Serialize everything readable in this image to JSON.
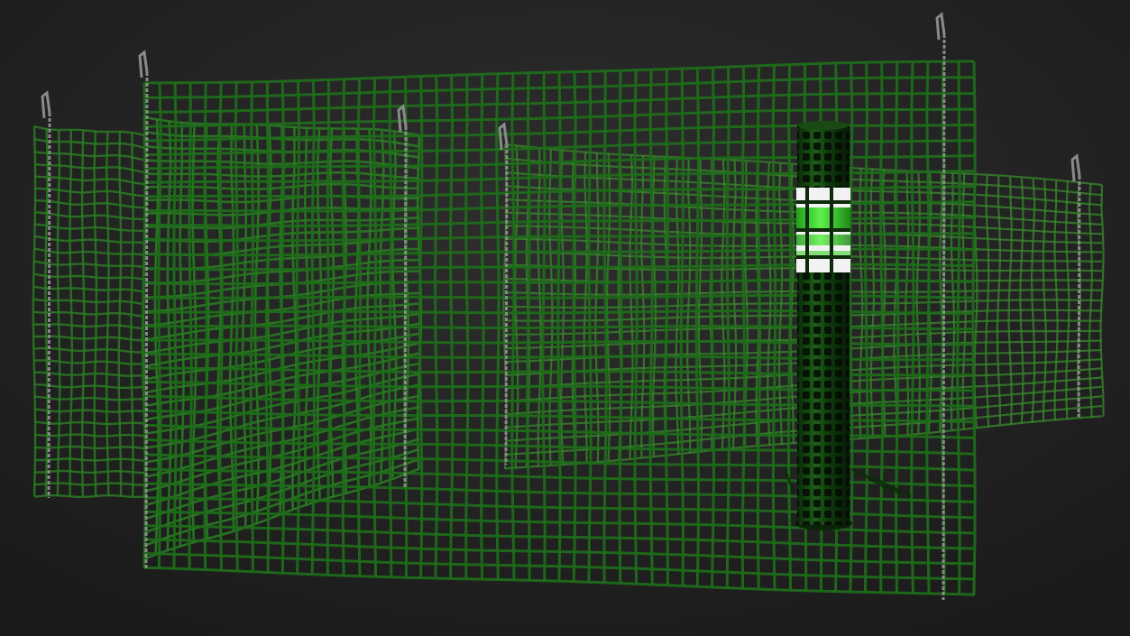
{
  "scene": {
    "subject": "green-safety-fence",
    "colors": {
      "background_top": "#2a2a2a",
      "background_bottom": "#1c1c1c",
      "mesh_front": "#1f6b1a",
      "mesh_mid": "#2a7a22",
      "mesh_back": "#3a8a2c",
      "roll_dark": "#0f3a0c",
      "roll_label_green": "#3bd12a",
      "roll_label_white": "#f2f2f2",
      "stake": "#8a8a8a",
      "stake_dark": "#5a5a5a"
    },
    "icons": [
      "fence-mesh-icon",
      "metal-stake-icon",
      "mesh-roll-icon"
    ]
  }
}
